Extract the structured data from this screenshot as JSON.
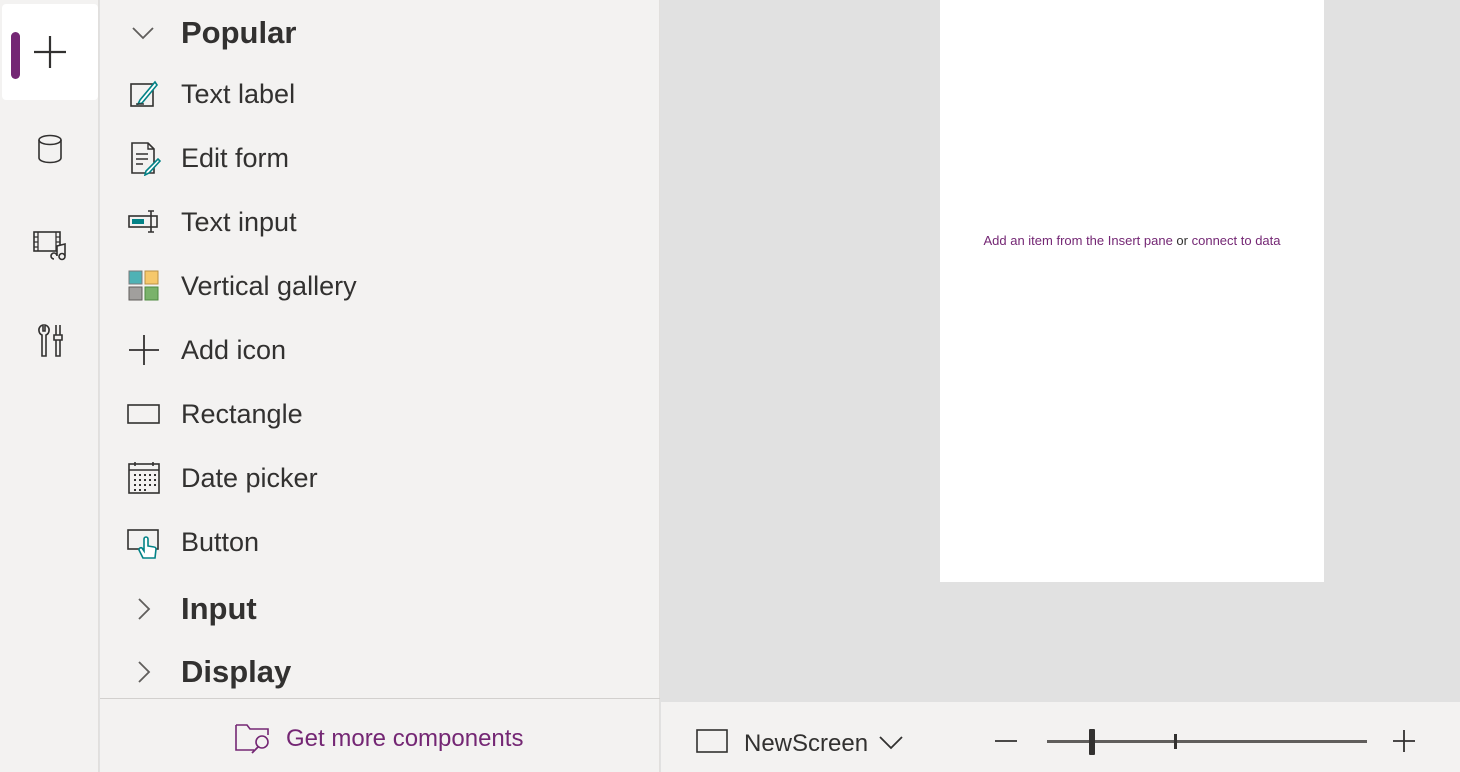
{
  "rail": {
    "items": [
      {
        "name": "Insert",
        "icon": "plus-icon",
        "active": true
      },
      {
        "name": "Data",
        "icon": "database-icon",
        "active": false
      },
      {
        "name": "Media",
        "icon": "media-icon",
        "active": false
      },
      {
        "name": "Advanced tools",
        "icon": "tools-icon",
        "active": false
      }
    ],
    "accent": "#742774"
  },
  "pane": {
    "sections": [
      {
        "title": "Popular",
        "expanded": true
      },
      {
        "title": "Input",
        "expanded": false
      },
      {
        "title": "Display",
        "expanded": false
      }
    ],
    "popular_items": [
      {
        "label": "Text label",
        "icon": "text-label-icon"
      },
      {
        "label": "Edit form",
        "icon": "edit-form-icon"
      },
      {
        "label": "Text input",
        "icon": "text-input-icon"
      },
      {
        "label": "Vertical gallery",
        "icon": "vertical-gallery-icon"
      },
      {
        "label": "Add icon",
        "icon": "add-icon"
      },
      {
        "label": "Rectangle",
        "icon": "rectangle-icon"
      },
      {
        "label": "Date picker",
        "icon": "date-picker-icon"
      },
      {
        "label": "Button",
        "icon": "button-icon"
      }
    ],
    "footer": {
      "label": "Get more components",
      "icon": "folder-search-icon"
    }
  },
  "canvas": {
    "hint_link1": "Add an item from the Insert pane",
    "hint_or": "or",
    "hint_link2": "connect to data"
  },
  "status": {
    "screen_name": "NewScreen",
    "zoom_icons": {
      "minus": "zoom-out-icon",
      "plus": "zoom-in-icon"
    }
  },
  "colors": {
    "accent": "#742774",
    "teal": "#038387",
    "pane_bg": "#f3f2f1",
    "canvas_bg": "#e1e1e1"
  }
}
